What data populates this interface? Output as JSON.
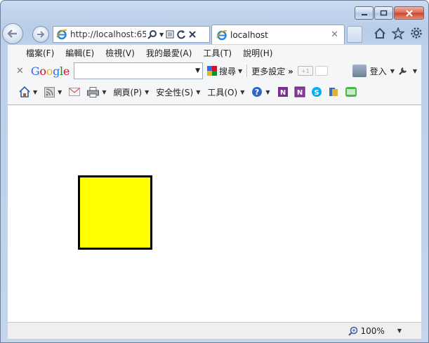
{
  "browser": {
    "address_url": "http://localhost:65",
    "tab_title": "localhost",
    "zoom_level": "100%"
  },
  "menubar": {
    "items": [
      "檔案(F)",
      "編輯(E)",
      "檢視(V)",
      "我的最愛(A)",
      "工具(T)",
      "說明(H)"
    ]
  },
  "googlebar": {
    "logo": "Google",
    "search_value": "",
    "search_label": "搜尋",
    "more_settings": "更多設定",
    "plus_one": "+1",
    "login": "登入"
  },
  "commandbar": {
    "page": "網頁(P)",
    "safety": "安全性(S)",
    "tools": "工具(O)"
  },
  "content": {
    "shape_fill": "#ffff00",
    "shape_border": "#000000"
  },
  "colors": {
    "window_frame": "#b9cde9",
    "close_button": "#c8432b"
  }
}
